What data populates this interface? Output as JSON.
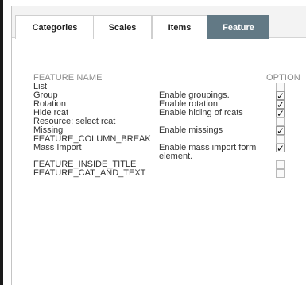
{
  "tabs": [
    {
      "label": "Categories",
      "active": false
    },
    {
      "label": "Scales",
      "active": false
    },
    {
      "label": "Items",
      "active": false
    },
    {
      "label": "Feature",
      "active": true
    }
  ],
  "table": {
    "col_name": "FEATURE NAME",
    "col_option": "OPTION"
  },
  "features": [
    {
      "name": "List",
      "description": "",
      "checked": false
    },
    {
      "name": "Group",
      "description": "Enable groupings.",
      "checked": true
    },
    {
      "name": "Rotation",
      "description": "Enable rotation",
      "checked": true
    },
    {
      "name": "Hide rcat",
      "description": "Enable hiding of rcats",
      "checked": true
    },
    {
      "name": "Resource: select rcat",
      "description": "",
      "checked": false
    },
    {
      "name": "Missing",
      "description": "Enable missings",
      "checked": true
    },
    {
      "name": "FEATURE_COLUMN_BREAK",
      "description": "",
      "checked": false
    },
    {
      "name": "Mass Import",
      "description": "Enable mass import form element.",
      "checked": true
    },
    {
      "name": "FEATURE_INSIDE_TITLE",
      "description": "",
      "checked": false
    },
    {
      "name": "FEATURE_CAT_AND_TEXT",
      "description": "",
      "checked": false
    }
  ],
  "check_glyph": "✓"
}
